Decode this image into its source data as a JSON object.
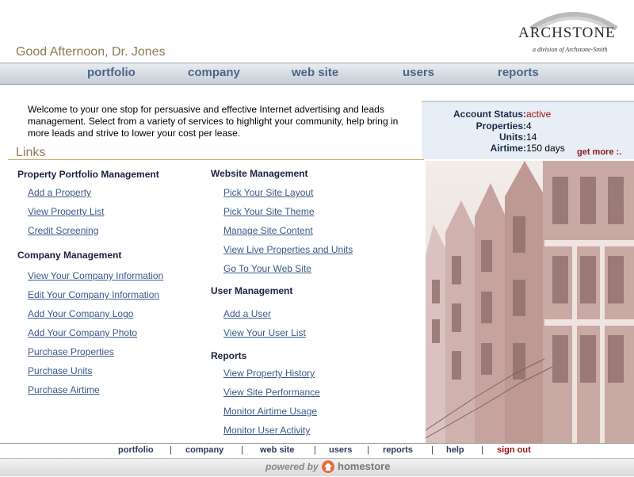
{
  "header": {
    "greeting": "Good Afternoon, Dr. Jones",
    "logo_text": "ARCHSTONE",
    "logo_subtitle": "a division of Archstone-Smith"
  },
  "nav": [
    "portfolio",
    "company",
    "web site",
    "users",
    "reports"
  ],
  "welcome": "Welcome to your one stop for persuasive and effective Internet advertising and leads management. Select from a variety of services to highlight your community, help bring in more leads and strive to lower your cost per lease.",
  "status": {
    "account_status_label": "Account Status:",
    "account_status": "active",
    "properties_label": "Properties:",
    "properties": "4",
    "units_label": "Units:",
    "units": "14",
    "airtime_label": "Airtime:",
    "airtime": "150 days",
    "get_more": "get more :."
  },
  "links_title": "Links",
  "sections": {
    "portfolio": {
      "title": "Property Portfolio Management",
      "links": [
        "Add a Property",
        "View Property List",
        "Credit Screening"
      ]
    },
    "company": {
      "title": "Company Management",
      "links": [
        "View Your Company Information",
        "Edit Your Company Information",
        "Add Your Company Logo",
        "Add Your Company Photo",
        "Purchase Properties",
        "Purchase Units",
        "Purchase Airtime"
      ]
    },
    "website": {
      "title": "Website Management",
      "links": [
        "Pick Your Site Layout",
        "Pick Your Site Theme",
        "Manage Site Content",
        "View Live Properties and Units",
        "Go To Your Web Site"
      ]
    },
    "users": {
      "title": "User Management",
      "links": [
        "Add a User",
        "View Your User List"
      ]
    },
    "reports": {
      "title": "Reports",
      "links": [
        "View Property History",
        "View Site Performance",
        "Monitor Airtime Usage",
        "Monitor User Activity"
      ]
    }
  },
  "footer_nav": [
    "portfolio",
    "company",
    "web site",
    "users",
    "reports",
    "help",
    "sign out"
  ],
  "footer": {
    "powered_by": "powered by",
    "brand": "homestore"
  },
  "colors": {
    "nav_text": "#4b6487",
    "link": "#3a5a8c",
    "accent_gold": "#8a7a55",
    "signout": "#9b1010"
  }
}
